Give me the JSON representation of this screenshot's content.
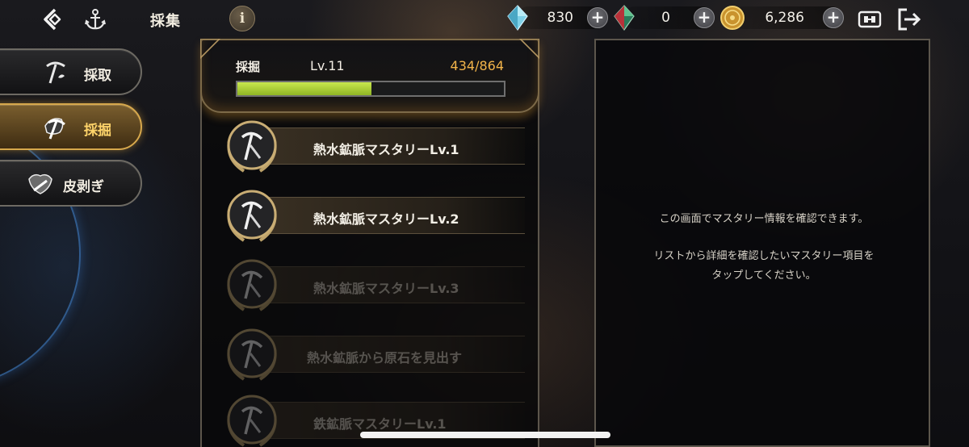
{
  "header": {
    "title": "採集",
    "info_label": "i",
    "currencies": [
      {
        "icon": "blue-crystal-icon",
        "value": "830"
      },
      {
        "icon": "red-green-gem-icon",
        "value": "0"
      },
      {
        "icon": "gold-coin-icon",
        "value": "6,286"
      }
    ],
    "plus_label": "+"
  },
  "sidebar": {
    "items": [
      {
        "label": "採取",
        "icon": "pickaxe-sprout-icon",
        "active": false
      },
      {
        "label": "採掘",
        "icon": "pickaxe-rock-icon",
        "active": true
      },
      {
        "label": "皮剥ぎ",
        "icon": "hide-knife-icon",
        "active": false
      }
    ]
  },
  "skill": {
    "name": "採掘",
    "level": "Lv.11",
    "exp": "434/864",
    "progress": 0.502
  },
  "mastery_list": [
    {
      "label": "熱水鉱脈マスタリーLv.1",
      "locked": false
    },
    {
      "label": "熱水鉱脈マスタリーLv.2",
      "locked": false
    },
    {
      "label": "熱水鉱脈マスタリーLv.3",
      "locked": true
    },
    {
      "label": "熱水鉱脈から原石を見出す",
      "locked": true
    },
    {
      "label": "鉄鉱脈マスタリーLv.1",
      "locked": true
    }
  ],
  "info_panel": {
    "line1": "この画面でマスタリー情報を確認できます。",
    "line2": "リストから詳細を確認したいマスタリー項目を",
    "line3": "タップしてください。"
  },
  "colors": {
    "accent_gold": "#f3b54a",
    "active_nav_gold": "#ffd46a",
    "exp_green": "#b6d93c"
  }
}
